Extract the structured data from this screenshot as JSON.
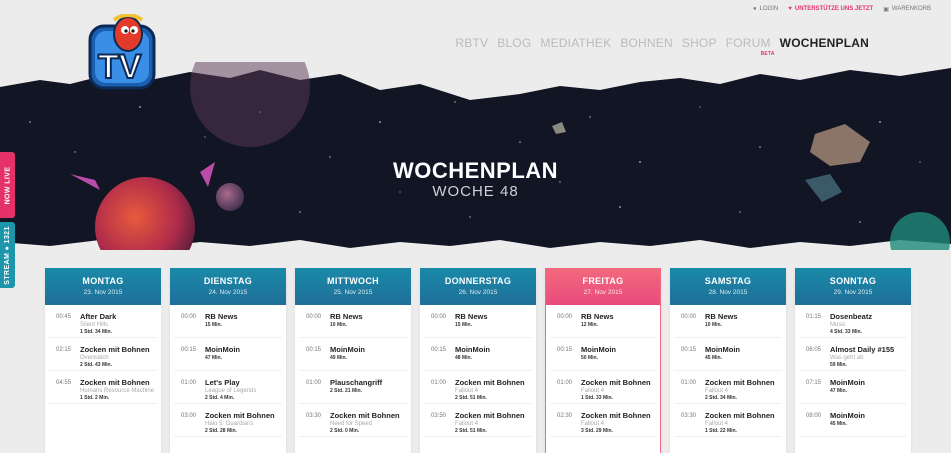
{
  "topbar": {
    "login": "LOGIN",
    "support": "UNTERSTÜTZE UNS JETZT",
    "cart": "WARENKORB"
  },
  "nav": {
    "items": [
      "RBTV",
      "BLOG",
      "MEDIATHEK",
      "BOHNEN",
      "SHOP",
      "FORUM"
    ],
    "beta": "BETA",
    "active": "WOCHENPLAN"
  },
  "logo": {
    "text": "TV"
  },
  "hero": {
    "title": "WOCHENPLAN",
    "subtitle": "WOCHE 48"
  },
  "side": {
    "live": "NOW LIVE",
    "stream": "STREAM",
    "count": "1321"
  },
  "days": [
    {
      "name": "MONTAG",
      "date": "23. Nov 2015",
      "events": [
        {
          "time": "00:45",
          "title": "After Dark",
          "game": "Silent Hills",
          "dur": "1 Std. 34 Min."
        },
        {
          "time": "02:15",
          "title": "Zocken mit Bohnen",
          "game": "Overwatch",
          "dur": "2 Std. 43 Min."
        },
        {
          "time": "04:55",
          "title": "Zocken mit Bohnen",
          "game": "Humans Resource Machine",
          "dur": "1 Std. 2 Min."
        }
      ]
    },
    {
      "name": "DIENSTAG",
      "date": "24. Nov 2015",
      "events": [
        {
          "time": "00:00",
          "title": "RB News",
          "game": "",
          "dur": "15 Min."
        },
        {
          "time": "00:15",
          "title": "MoinMoin",
          "game": "",
          "dur": "47 Min."
        },
        {
          "time": "01:00",
          "title": "Let's Play",
          "game": "League of Legends",
          "dur": "2 Std. 4 Min."
        },
        {
          "time": "03:00",
          "title": "Zocken mit Bohnen",
          "game": "Halo 5: Guardians",
          "dur": "2 Std. 28 Min."
        }
      ]
    },
    {
      "name": "MITTWOCH",
      "date": "25. Nov 2015",
      "events": [
        {
          "time": "00:00",
          "title": "RB News",
          "game": "",
          "dur": "10 Min."
        },
        {
          "time": "00:15",
          "title": "MoinMoin",
          "game": "",
          "dur": "49 Min."
        },
        {
          "time": "01:00",
          "title": "Plauschangriff",
          "game": "",
          "dur": "2 Std. 21 Min."
        },
        {
          "time": "03:30",
          "title": "Zocken mit Bohnen",
          "game": "Need for Speed",
          "dur": "2 Std. 0 Min."
        }
      ]
    },
    {
      "name": "DONNERSTAG",
      "date": "26. Nov 2015",
      "events": [
        {
          "time": "00:00",
          "title": "RB News",
          "game": "",
          "dur": "15 Min."
        },
        {
          "time": "00:15",
          "title": "MoinMoin",
          "game": "",
          "dur": "48 Min."
        },
        {
          "time": "01:00",
          "title": "Zocken mit Bohnen",
          "game": "Fallout 4",
          "dur": "2 Std. 51 Min."
        },
        {
          "time": "03:50",
          "title": "Zocken mit Bohnen",
          "game": "Fallout 4",
          "dur": "2 Std. 51 Min."
        }
      ]
    },
    {
      "name": "FREITAG",
      "date": "27. Nov 2015",
      "events": [
        {
          "time": "00:00",
          "title": "RB News",
          "game": "",
          "dur": "12 Min."
        },
        {
          "time": "00:15",
          "title": "MoinMoin",
          "game": "",
          "dur": "50 Min."
        },
        {
          "time": "01:00",
          "title": "Zocken mit Bohnen",
          "game": "Fallout 4",
          "dur": "1 Std. 33 Min."
        },
        {
          "time": "02:30",
          "title": "Zocken mit Bohnen",
          "game": "Fallout 4",
          "dur": "3 Std. 29 Min."
        }
      ]
    },
    {
      "name": "SAMSTAG",
      "date": "28. Nov 2015",
      "events": [
        {
          "time": "00:00",
          "title": "RB News",
          "game": "",
          "dur": "10 Min."
        },
        {
          "time": "00:15",
          "title": "MoinMoin",
          "game": "",
          "dur": "45 Min."
        },
        {
          "time": "01:00",
          "title": "Zocken mit Bohnen",
          "game": "Fallout 4",
          "dur": "2 Std. 34 Min."
        },
        {
          "time": "03:30",
          "title": "Zocken mit Bohnen",
          "game": "Fallout 4",
          "dur": "1 Std. 22 Min."
        }
      ]
    },
    {
      "name": "SONNTAG",
      "date": "29. Nov 2015",
      "events": [
        {
          "time": "01:15",
          "title": "Dosenbeatz",
          "game": "Music",
          "dur": "4 Std. 33 Min."
        },
        {
          "time": "06:05",
          "title": "Almost Daily #155",
          "game": "Was geht ab",
          "dur": "59 Min."
        },
        {
          "time": "07:15",
          "title": "MoinMoin",
          "game": "",
          "dur": "47 Min."
        },
        {
          "time": "08:00",
          "title": "MoinMoin",
          "game": "",
          "dur": "45 Min."
        }
      ]
    }
  ],
  "colors": {
    "accent": "#1d8aa8",
    "today": "#f0607a",
    "pink": "#e5316a"
  }
}
